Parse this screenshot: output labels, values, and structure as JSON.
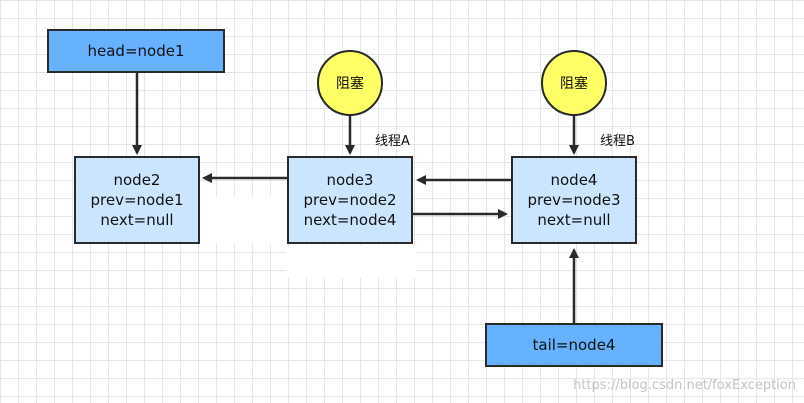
{
  "head_box": {
    "label": "head=node1"
  },
  "tail_box": {
    "label": "tail=node4"
  },
  "blocked_left": {
    "label": "阻塞"
  },
  "blocked_right": {
    "label": "阻塞"
  },
  "thread_a": {
    "label": "线程A"
  },
  "thread_b": {
    "label": "线程B"
  },
  "node2": {
    "lines": [
      "node2",
      "prev=node1",
      "next=null"
    ]
  },
  "node3": {
    "lines": [
      "node3",
      "prev=node2",
      "next=node4"
    ]
  },
  "node4": {
    "lines": [
      "node4",
      "prev=node3",
      "next=null"
    ]
  },
  "watermark": "https://blog.csdn.net/foxException",
  "colors": {
    "pointer_fill": "#66b2ff",
    "node_fill": "#cce5ff",
    "blocked_fill": "#ffff66",
    "stroke": "#2a2a2a",
    "grid": "#e6e6e6"
  }
}
